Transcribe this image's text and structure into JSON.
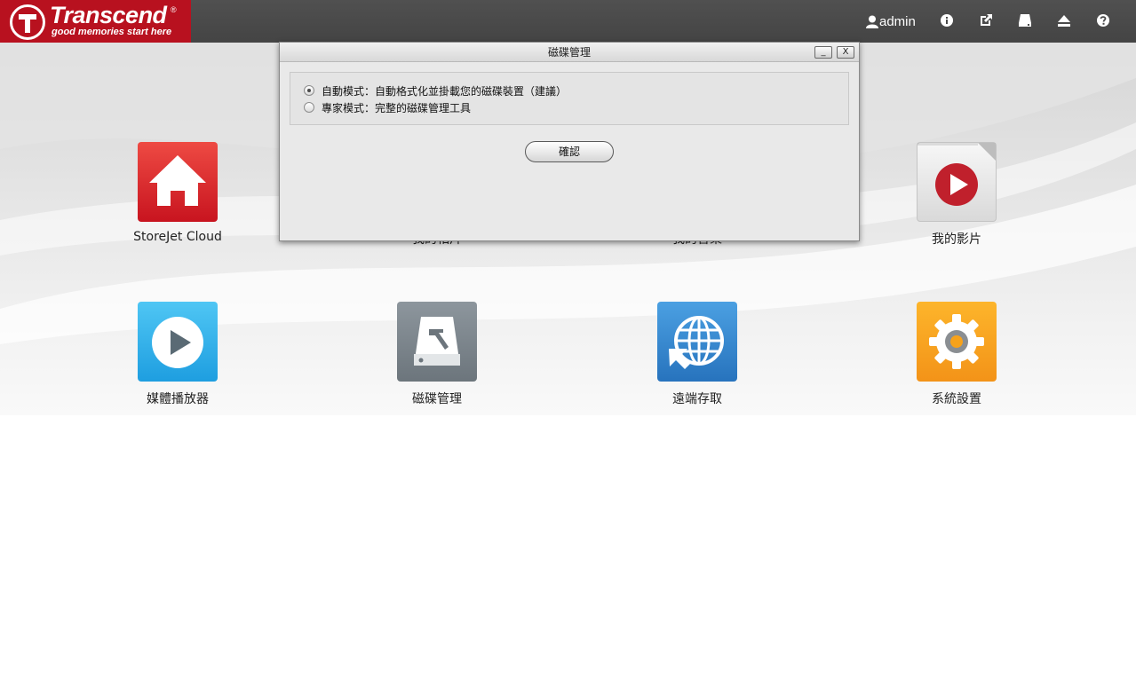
{
  "header": {
    "logo_name": "Transcend",
    "logo_reg": "®",
    "logo_tagline": "good memories start here",
    "username": "admin",
    "icons": [
      "user-icon",
      "info-icon",
      "external-link-icon",
      "drive-icon",
      "eject-icon",
      "help-icon"
    ]
  },
  "apps": [
    {
      "label": "StoreJet Cloud",
      "icon": "home-icon",
      "color": "#d8262f"
    },
    {
      "label": "我的相片",
      "icon": "photo-icon",
      "color": "#3a8fd8"
    },
    {
      "label": "我的音樂",
      "icon": "music-icon",
      "color": "#8b4fc4"
    },
    {
      "label": "我的影片",
      "icon": "video-play-icon",
      "color": "#c0202c"
    },
    {
      "label": "媒體播放器",
      "icon": "media-player-icon",
      "color": "#2aa8e6"
    },
    {
      "label": "磁碟管理",
      "icon": "disk-management-icon",
      "color": "#7d868d"
    },
    {
      "label": "遠端存取",
      "icon": "globe-icon",
      "color": "#2f86cc"
    },
    {
      "label": "系統設置",
      "icon": "gear-icon",
      "color": "#f7a21b"
    }
  ],
  "dialog": {
    "title": "磁碟管理",
    "minimize": "_",
    "close": "X",
    "options": [
      {
        "label": "自動模式：自動格式化並掛載您的磁碟裝置（建議）",
        "checked": true
      },
      {
        "label": "專家模式：完整的磁碟管理工具",
        "checked": false
      }
    ],
    "confirm_label": "確認"
  }
}
